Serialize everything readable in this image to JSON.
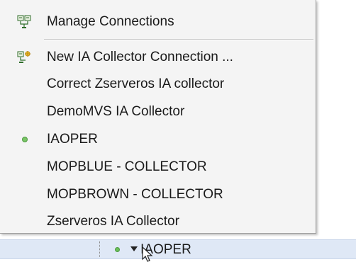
{
  "menu": {
    "manage_connections": {
      "label": "Manage Connections",
      "icon": "manage-connections-icon"
    },
    "new_connection": {
      "label": "New IA Collector Connection ...",
      "icon": "new-connection-icon"
    },
    "connections": [
      {
        "label": "Correct Zserveros IA collector",
        "selected": false
      },
      {
        "label": "DemoMVS IA Collector",
        "selected": false
      },
      {
        "label": "IAOPER",
        "selected": true
      },
      {
        "label": "MOPBLUE  - COLLECTOR",
        "selected": false
      },
      {
        "label": "MOPBROWN  - COLLECTOR",
        "selected": false
      },
      {
        "label": "Zserveros IA Collector",
        "selected": false
      }
    ]
  },
  "tree": {
    "node_label": "IAOPER",
    "status_color": "#6cbf5a"
  },
  "colors": {
    "menu_background": "#f4f4f4",
    "tree_selection": "#dfe8f6",
    "active_dot": "#79c466"
  }
}
